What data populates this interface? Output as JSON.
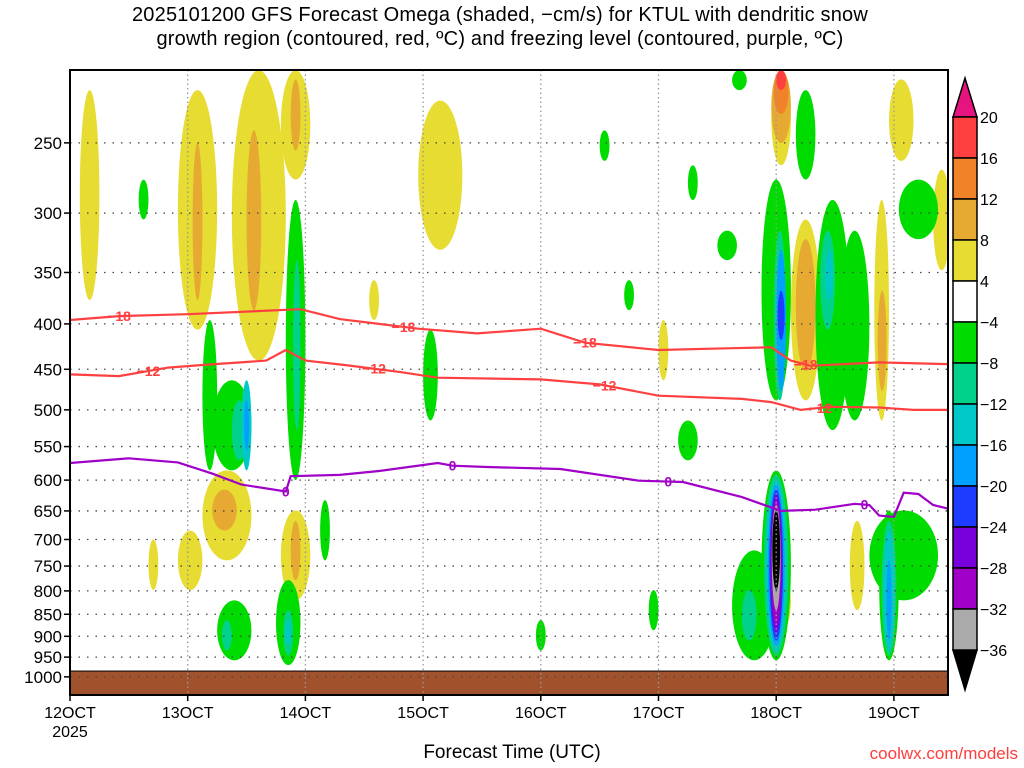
{
  "chart_data": {
    "type": "heatmap",
    "title_line1": "2025101200 GFS Forecast Omega (shaded, −cm/s) for KTUL with dendritic snow",
    "title_line2": "growth region (contoured, red, ºC) and freezing level (contoured, purple, ºC)",
    "xlabel": "Forecast Time (UTC)",
    "ylabel": "",
    "credit": "coolwx.com/models",
    "x_units": "forecast hour from 12 Oct 2025 00 UTC",
    "xlim": [
      0,
      179
    ],
    "ylim_hpa": [
      1048,
      207
    ],
    "y_scale": "log",
    "x_ticks": [
      {
        "hour": 0,
        "label": "12OCT",
        "sub": "2025"
      },
      {
        "hour": 24,
        "label": "13OCT"
      },
      {
        "hour": 48,
        "label": "14OCT"
      },
      {
        "hour": 72,
        "label": "15OCT"
      },
      {
        "hour": 96,
        "label": "16OCT"
      },
      {
        "hour": 120,
        "label": "17OCT"
      },
      {
        "hour": 144,
        "label": "18OCT"
      },
      {
        "hour": 168,
        "label": "19OCT"
      }
    ],
    "y_ticks": [
      250,
      300,
      350,
      400,
      450,
      500,
      550,
      600,
      650,
      700,
      750,
      800,
      850,
      900,
      950,
      1000
    ],
    "surface_pressure_hpa": 985,
    "colorbar": {
      "labels": [
        "20",
        "16",
        "12",
        "8",
        "4",
        "−4",
        "−8",
        "−12",
        "−16",
        "−20",
        "−24",
        "−28",
        "−32",
        "−36"
      ],
      "colors": [
        "#ff4040",
        "#f08228",
        "#e6aa32",
        "#e6dc32",
        "#ffffff",
        "#00dc00",
        "#00d28c",
        "#00c8c8",
        "#00a0ff",
        "#1e3cff",
        "#7800dc",
        "#a000c8",
        "#aaaaaa"
      ],
      "over_color": "#e6147e",
      "under_color": "#000000"
    },
    "shaded_regions_note": "[hour_start, hour_end, p_top_hPa, p_bottom_hPa, omega_value]",
    "shaded_regions": [
      [
        2,
        6,
        218,
        376,
        6
      ],
      [
        22,
        30,
        218,
        406,
        6
      ],
      [
        25,
        27,
        250,
        376,
        10
      ],
      [
        33,
        44,
        207,
        440,
        6
      ],
      [
        36,
        39,
        242,
        386,
        10
      ],
      [
        43,
        49,
        207,
        275,
        6
      ],
      [
        45,
        47,
        212,
        255,
        10
      ],
      [
        71,
        80,
        224,
        330,
        6
      ],
      [
        27,
        37,
        585,
        739,
        6
      ],
      [
        29,
        34,
        615,
        684,
        10
      ],
      [
        43,
        49,
        649,
        820,
        6
      ],
      [
        45,
        47,
        667,
        778,
        10
      ],
      [
        22,
        27,
        684,
        798,
        6
      ],
      [
        143,
        147,
        207,
        265,
        6
      ],
      [
        143,
        147,
        207,
        250,
        10
      ],
      [
        143.5,
        146.5,
        207,
        232,
        14
      ],
      [
        144,
        146,
        207,
        218,
        18
      ],
      [
        147,
        153,
        305,
        488,
        6
      ],
      [
        148,
        152,
        321,
        452,
        10
      ],
      [
        164,
        167,
        290,
        514,
        6
      ],
      [
        164.7,
        166.5,
        367,
        476,
        10
      ],
      [
        167,
        172,
        212,
        262,
        6
      ],
      [
        176,
        179.5,
        268,
        348,
        6
      ],
      [
        159,
        162,
        667,
        841,
        6
      ],
      [
        144,
        147,
        770,
        880,
        6
      ],
      [
        144.5,
        146.5,
        798,
        863,
        10
      ],
      [
        120,
        122,
        396,
        463,
        6
      ],
      [
        61,
        63,
        357,
        396,
        6
      ],
      [
        16,
        18,
        700,
        798,
        6
      ],
      [
        27,
        30,
        396,
        585,
        -6
      ],
      [
        29,
        37,
        463,
        585,
        -6
      ],
      [
        33,
        36,
        488,
        570,
        -10
      ],
      [
        35,
        37,
        463,
        585,
        -14
      ],
      [
        35.5,
        36.5,
        488,
        555,
        -18
      ],
      [
        44,
        48,
        290,
        600,
        -6
      ],
      [
        45.5,
        47,
        339,
        527,
        -10
      ],
      [
        30,
        37,
        820,
        958,
        -6
      ],
      [
        31,
        33,
        863,
        934,
        -10
      ],
      [
        42,
        47,
        778,
        970,
        -6
      ],
      [
        43.5,
        45.5,
        841,
        946,
        -10
      ],
      [
        44,
        45,
        863,
        920,
        -14
      ],
      [
        135,
        144,
        720,
        958,
        -6
      ],
      [
        137,
        140,
        798,
        910,
        -10
      ],
      [
        141,
        147,
        585,
        958,
        -6
      ],
      [
        141.5,
        146.5,
        592,
        946,
        -10
      ],
      [
        142,
        146,
        600,
        934,
        -14
      ],
      [
        142.3,
        145.7,
        607,
        922,
        -18
      ],
      [
        142.6,
        145.4,
        615,
        910,
        -22
      ],
      [
        142.8,
        145.2,
        623,
        892,
        -26
      ],
      [
        143,
        145,
        632,
        875,
        -30
      ],
      [
        143.1,
        144.9,
        640,
        841,
        -34
      ],
      [
        143.2,
        144.8,
        649,
        798,
        -40
      ],
      [
        141,
        147,
        275,
        488,
        -6
      ],
      [
        143.5,
        146,
        314,
        488,
        -10
      ],
      [
        144,
        146,
        330,
        476,
        -18
      ],
      [
        144.3,
        145.7,
        367,
        417,
        -22
      ],
      [
        148,
        152,
        218,
        275,
        -6
      ],
      [
        152,
        159,
        290,
        527,
        -6
      ],
      [
        153,
        156,
        314,
        406,
        -10
      ],
      [
        154,
        155.5,
        330,
        376,
        -14
      ],
      [
        157,
        163,
        314,
        514,
        -6
      ],
      [
        163,
        177,
        649,
        820,
        -6
      ],
      [
        165,
        169,
        649,
        958,
        -6
      ],
      [
        165.5,
        168.5,
        667,
        946,
        -10
      ],
      [
        166,
        168,
        684,
        934,
        -14
      ],
      [
        166.5,
        167.5,
        739,
        910,
        -18
      ],
      [
        169,
        177,
        275,
        321,
        -6
      ],
      [
        132,
        136,
        314,
        339,
        -6
      ],
      [
        126,
        128,
        265,
        290,
        -6
      ],
      [
        135,
        138,
        207,
        218,
        -6
      ],
      [
        124,
        128,
        514,
        570,
        -6
      ],
      [
        118,
        120,
        798,
        886,
        -6
      ],
      [
        51,
        53,
        632,
        739,
        -6
      ],
      [
        14,
        16,
        275,
        305,
        -6
      ],
      [
        72,
        75,
        406,
        514,
        -6
      ],
      [
        108,
        110,
        242,
        262,
        -6
      ],
      [
        113,
        115,
        357,
        386,
        -6
      ],
      [
        95,
        97,
        863,
        934,
        -6
      ]
    ],
    "contours": [
      {
        "name": "-18",
        "color": "#ff4040",
        "label": "−18",
        "label_hours": [
          10,
          68,
          105,
          150
        ],
        "points": [
          [
            0,
            396
          ],
          [
            10,
            392
          ],
          [
            24,
            390
          ],
          [
            47,
            385
          ],
          [
            55,
            395
          ],
          [
            71,
            405
          ],
          [
            83,
            410
          ],
          [
            96,
            405
          ],
          [
            105,
            420
          ],
          [
            120,
            428
          ],
          [
            135,
            426
          ],
          [
            143,
            425
          ],
          [
            147,
            440
          ],
          [
            151,
            446
          ],
          [
            165,
            442
          ],
          [
            179,
            444
          ]
        ]
      },
      {
        "name": "-12",
        "color": "#ff4040",
        "label": "−12",
        "label_hours": [
          16,
          62,
          109,
          153
        ],
        "points": [
          [
            0,
            456
          ],
          [
            10,
            458
          ],
          [
            20,
            448
          ],
          [
            27,
            445
          ],
          [
            40,
            440
          ],
          [
            44,
            428
          ],
          [
            48,
            440
          ],
          [
            56,
            445
          ],
          [
            67,
            453
          ],
          [
            75,
            460
          ],
          [
            96,
            462
          ],
          [
            108,
            468
          ],
          [
            120,
            482
          ],
          [
            137,
            486
          ],
          [
            143,
            490
          ],
          [
            149,
            500
          ],
          [
            155,
            496
          ],
          [
            165,
            497
          ],
          [
            172,
            500
          ],
          [
            179,
            500
          ]
        ]
      },
      {
        "name": "0",
        "color": "#a000c8",
        "label": "0",
        "label_hours": [
          44,
          78,
          122,
          162
        ],
        "points": [
          [
            0,
            574
          ],
          [
            12,
            567
          ],
          [
            22,
            573
          ],
          [
            29,
            590
          ],
          [
            35,
            607
          ],
          [
            44,
            618
          ],
          [
            45,
            594
          ],
          [
            55,
            592
          ],
          [
            63,
            586
          ],
          [
            75,
            574
          ],
          [
            78,
            578
          ],
          [
            85,
            580
          ],
          [
            100,
            583
          ],
          [
            116,
            601
          ],
          [
            125,
            603
          ],
          [
            137,
            627
          ],
          [
            145,
            650
          ],
          [
            152,
            648
          ],
          [
            160,
            638
          ],
          [
            163,
            640
          ],
          [
            165,
            658
          ],
          [
            168,
            660
          ],
          [
            170,
            620
          ],
          [
            173,
            622
          ],
          [
            176,
            640
          ],
          [
            179,
            646
          ]
        ]
      }
    ]
  }
}
